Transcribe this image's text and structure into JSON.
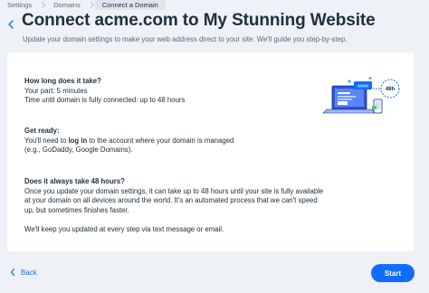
{
  "breadcrumb": [
    "Settings",
    "Domains",
    "Connect a Domain"
  ],
  "header": {
    "title": "Connect acme.com to My Stunning Website",
    "subtitle": "Update your domain settings to make your web address direct to your site. We'll guide you step-by-step."
  },
  "sections": {
    "how_long": {
      "heading": "How long does it take?",
      "line1": "Your part: 5 minutes",
      "line2": "Time until domain is fully connected: up to 48 hours"
    },
    "get_ready": {
      "heading": "Get ready:",
      "line1_before": "You'll need to ",
      "line1_bold": "log in",
      "line1_after": " to the account where your domain is managed",
      "line2": "(e.g., GoDaddy, Google Domains)."
    },
    "always_48": {
      "heading": "Does it always take 48 hours?",
      "body": "Once you update your domain settings, it can take up to 48 hours until your site is fully available at your domain on all devices around the world. It's an automated process that we can't speed up, but sometimes finishes faster."
    },
    "updates": "We'll keep you updated at every step via text message or email."
  },
  "illustration": {
    "www_label": "www",
    "timer_label": "48h"
  },
  "footer": {
    "back_label": "Back",
    "start_label": "Start"
  },
  "colors": {
    "accent": "#116dff",
    "background": "#eef1f6",
    "text": "#20303c"
  }
}
